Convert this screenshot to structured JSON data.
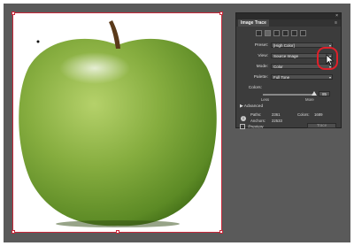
{
  "panel": {
    "title": "Image Trace",
    "close_glyph": "×",
    "menu_glyph": "≡",
    "preset_label": "Preset:",
    "preset_value": "[High Color]",
    "view_label": "View:",
    "view_value": "Source Image",
    "mode_label": "Mode:",
    "mode_value": "Color",
    "palette_label": "Palette:",
    "palette_value": "Full Tone",
    "colors_label": "Colors:",
    "colors_value": "85",
    "less_label": "Less",
    "more_label": "More",
    "advanced_label": "Advanced",
    "paths_label": "Paths:",
    "paths_value": "2361",
    "anchors_label": "Anchors:",
    "anchors_value": "22533",
    "colors_count_label": "Colors:",
    "colors_count_value": "1689",
    "preview_label": "Preview",
    "trace_label": "Trace",
    "info_glyph": "i",
    "disclosure_glyph": "▶",
    "chevron_glyph": "▾",
    "preset_icons": [
      "auto-color-icon",
      "high-color-icon",
      "low-color-icon",
      "grayscale-icon",
      "black-white-icon",
      "outline-icon"
    ]
  },
  "colors": {
    "highlight": "#e0202a",
    "artboard_border": "#c8283a",
    "apple_green": "#7fa83a",
    "pasteboard": "#5a5a5a"
  }
}
